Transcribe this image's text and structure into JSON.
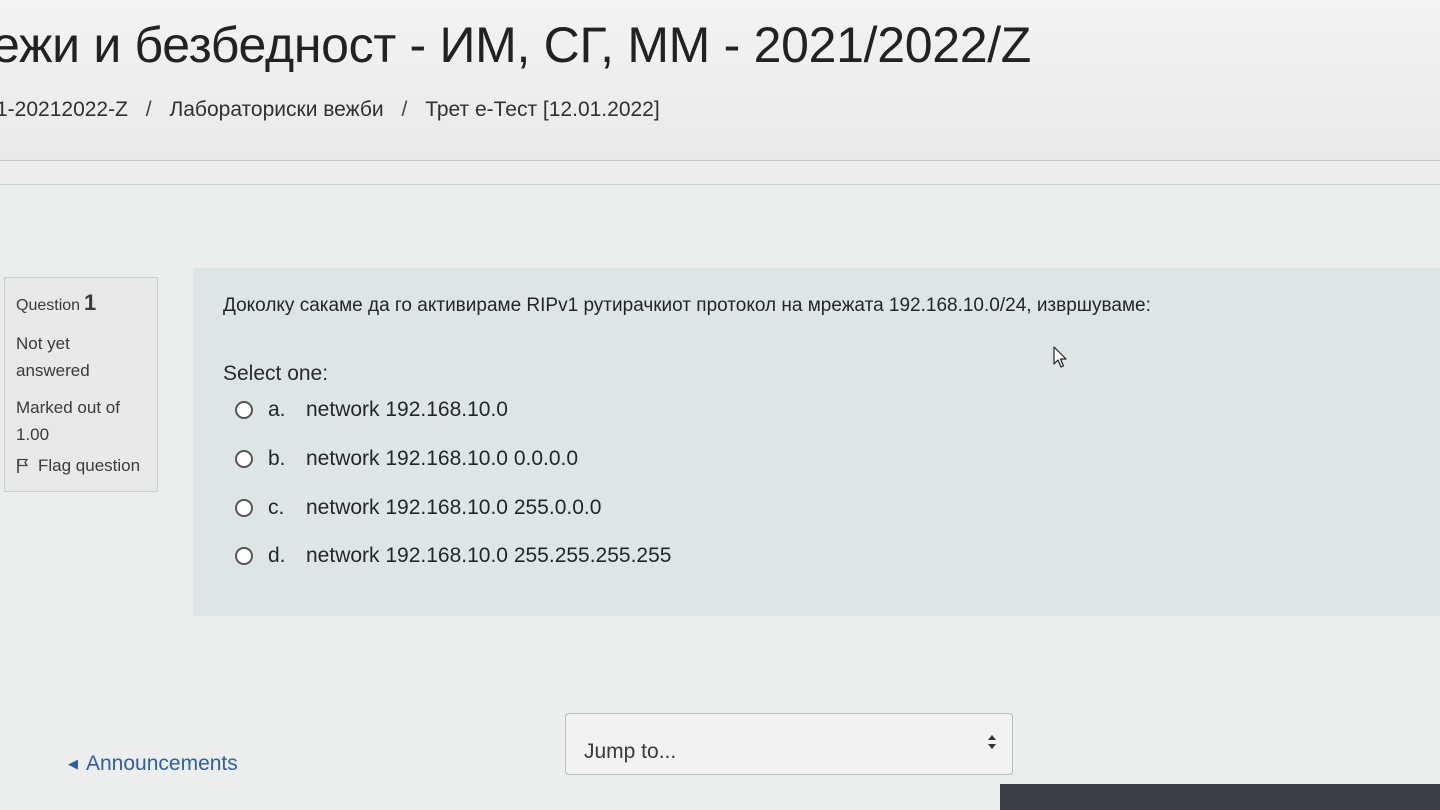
{
  "header": {
    "course_title": "ежи и безбедност - ИМ, СГ, ММ - 2021/2022/Z",
    "breadcrumb": [
      "1-20212022-Z",
      "Лабораториски вежби",
      "Трет е-Тест [12.01.2022]"
    ],
    "breadcrumb_separator": "/"
  },
  "question_info": {
    "label": "Question",
    "number": "1",
    "state": "Not yet answered",
    "marked": "Marked out of 1.00",
    "flag_label": "Flag question"
  },
  "question": {
    "text": "Доколку сакаме да го активираме RIPv1 рутирачкиот протокол на мрежата 192.168.10.0/24, извршуваме:",
    "prompt": "Select one:",
    "answers": [
      {
        "letter": "a.",
        "text": "network 192.168.10.0"
      },
      {
        "letter": "b.",
        "text": "network 192.168.10.0 0.0.0.0"
      },
      {
        "letter": "c.",
        "text": "network 192.168.10.0 255.0.0.0"
      },
      {
        "letter": "d.",
        "text": "network 192.168.10.0 255.255.255.255"
      }
    ]
  },
  "navigation": {
    "prev_link": "Announcements",
    "jump_placeholder": "Jump to..."
  },
  "colors": {
    "content_bg": "#dde6e5",
    "link": "#2d5fa8"
  }
}
